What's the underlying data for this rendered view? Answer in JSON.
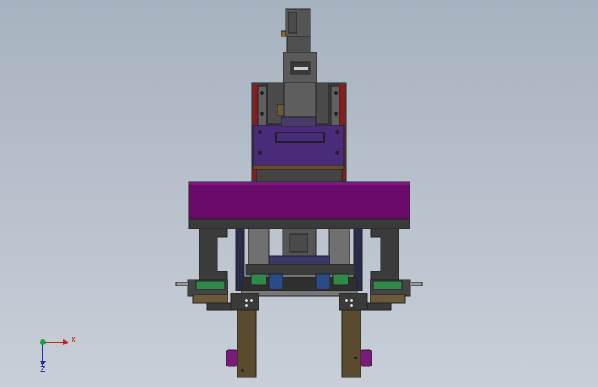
{
  "viewport": {
    "background_top": "#a7b2c0",
    "background_bottom": "#c8cfd8"
  },
  "colors": {
    "frame_dark": "#3b3b3b",
    "frame_mid": "#5d5d5d",
    "plate_purple": "#6a0a6a",
    "plate_purple_top": "#7a1a7a",
    "bracket_purple": "#4a2a7a",
    "red_panel": "#8b1c1c",
    "leg_brown": "#5a4a2e",
    "green_sensor": "#2f8a4a",
    "blue_block": "#2a4a8a",
    "pad_purple": "#7a1a7a"
  },
  "triad": {
    "x_label": "X",
    "z_label": "Z",
    "x_color": "#d02020",
    "y_color": "#20a040",
    "z_color": "#2030b0"
  }
}
